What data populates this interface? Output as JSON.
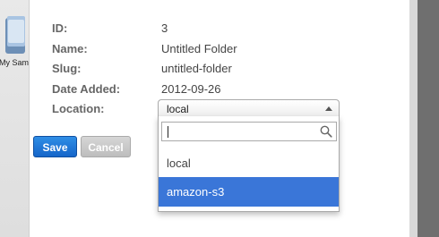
{
  "desktop": {
    "icon_label": "My Sam"
  },
  "details": {
    "id_label": "ID:",
    "id_value": "3",
    "name_label": "Name:",
    "name_value": "Untitled Folder",
    "slug_label": "Slug:",
    "slug_value": "untitled-folder",
    "date_label": "Date Added:",
    "date_value": "2012-09-26",
    "location_label": "Location:"
  },
  "location_select": {
    "selected": "local",
    "search_value": "",
    "options": [
      "local",
      "amazon-s3"
    ],
    "highlighted": "amazon-s3"
  },
  "buttons": {
    "save_label": "Save",
    "cancel_label": "Cancel"
  },
  "colors": {
    "accent": "#3a76d8",
    "save_button": "#1f78d6",
    "cancel_button": "#c8c8c8"
  }
}
